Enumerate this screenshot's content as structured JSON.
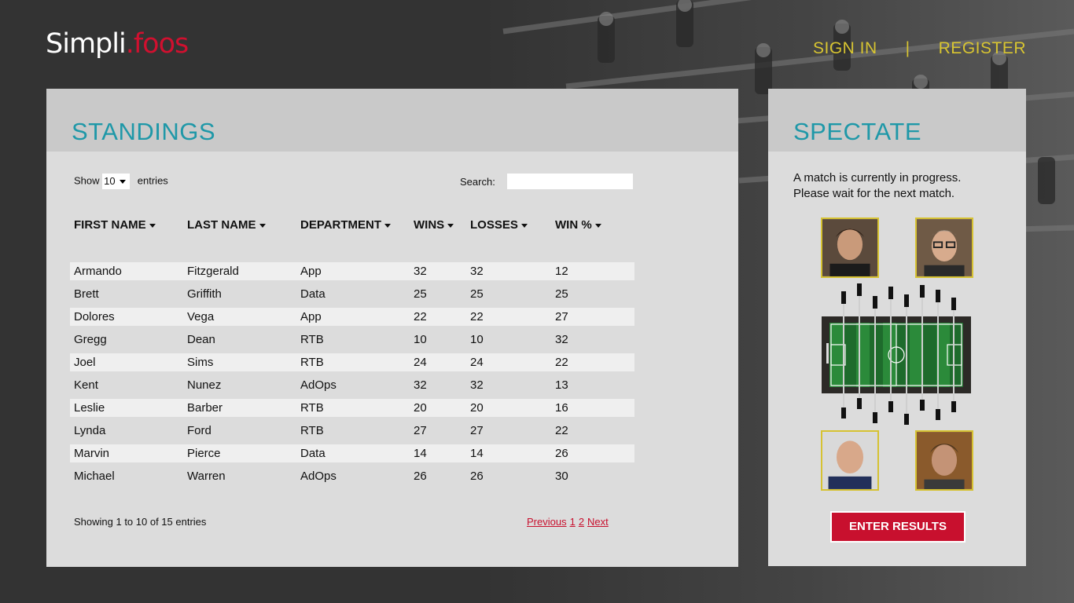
{
  "brand": {
    "logo_left": "Simpli",
    "logo_dot": ".",
    "logo_right": "foos"
  },
  "nav": {
    "sign_in": "SIGN IN",
    "separator": "|",
    "register": "REGISTER"
  },
  "standings": {
    "title": "STANDINGS",
    "show_label": "Show",
    "show_value": "10",
    "entries_label": "entries",
    "search_label": "Search:",
    "search_value": "",
    "columns": [
      "FIRST NAME",
      "LAST NAME",
      "DEPARTMENT",
      "WINS",
      "LOSSES",
      "WIN %"
    ],
    "rows": [
      [
        "Armando",
        "Fitzgerald",
        "App",
        "32",
        "32",
        "12"
      ],
      [
        "Brett",
        "Griffith",
        "Data",
        "25",
        "25",
        "25"
      ],
      [
        "Dolores",
        "Vega",
        "App",
        "22",
        "22",
        "27"
      ],
      [
        "Gregg",
        "Dean",
        "RTB",
        "10",
        "10",
        "32"
      ],
      [
        "Joel",
        "Sims",
        "RTB",
        "24",
        "24",
        "22"
      ],
      [
        "Kent",
        "Nunez",
        "AdOps",
        "32",
        "32",
        "13"
      ],
      [
        "Leslie",
        "Barber",
        "RTB",
        "20",
        "20",
        "16"
      ],
      [
        "Lynda",
        "Ford",
        "RTB",
        "27",
        "27",
        "22"
      ],
      [
        "Marvin",
        "Pierce",
        "Data",
        "14",
        "14",
        "26"
      ],
      [
        "Michael",
        "Warren",
        "AdOps",
        "26",
        "26",
        "30"
      ]
    ],
    "info": "Showing 1 to 10 of 15 entries",
    "pager": {
      "previous": "Previous",
      "pages": [
        "1",
        "2"
      ],
      "next": "Next"
    }
  },
  "spectate": {
    "title": "SPECTATE",
    "message_line1": "A match is currently in progress.",
    "message_line2": "Please wait for the next match.",
    "enter_button": "ENTER RESULTS"
  },
  "colors": {
    "background": "#333333",
    "panel": "#dcdcdc",
    "panel_header": "#c9c9c9",
    "heading": "#1f98a8",
    "nav": "#d8c531",
    "accent_red": "#c8102e",
    "avatar_border": "#d6c232"
  },
  "icons": {
    "sort": "caret-down-icon",
    "select": "caret-down-icon"
  }
}
